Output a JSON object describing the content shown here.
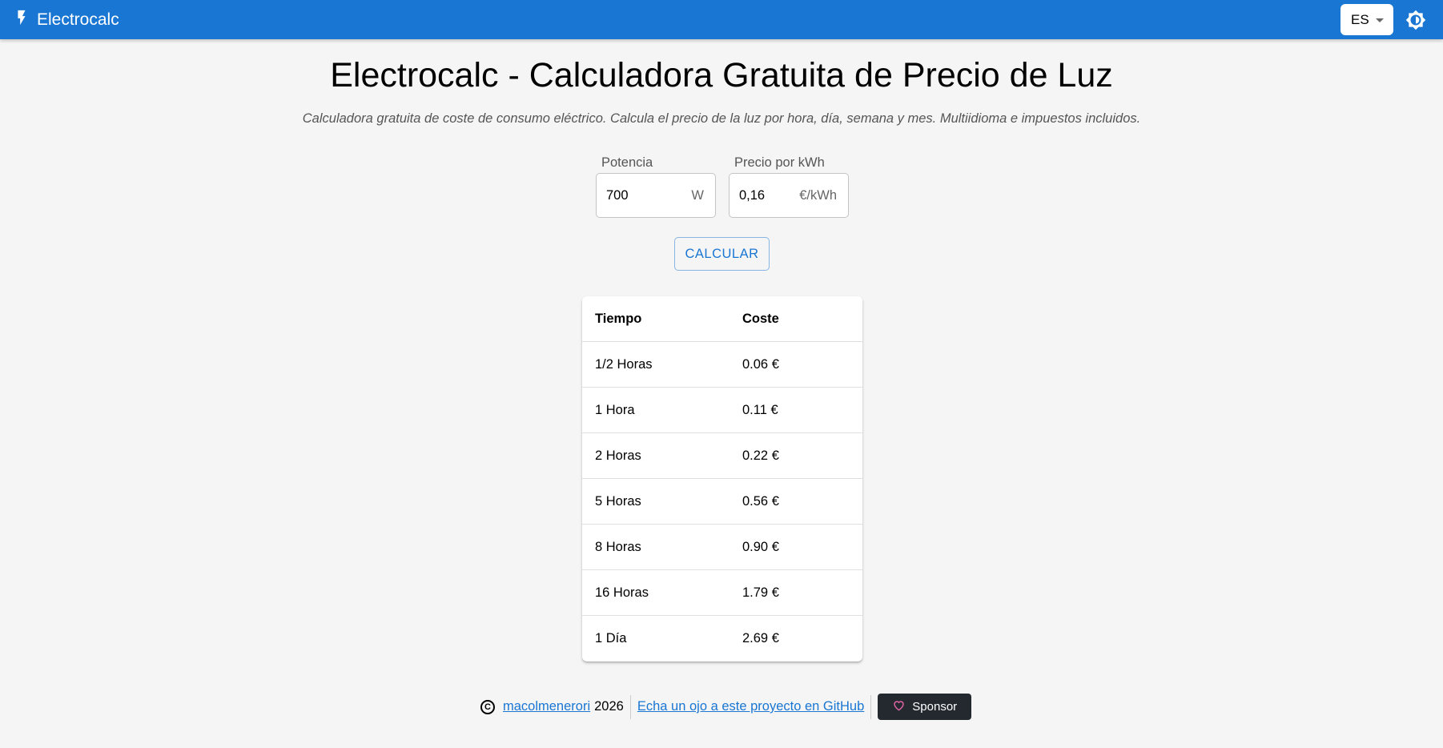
{
  "header": {
    "brand_icon": "bolt-icon",
    "brand": "Electrocalc",
    "language": "ES",
    "theme_icon": "brightness-icon",
    "color": "#1976d2"
  },
  "page": {
    "title": "Electrocalc - Calculadora Gratuita de Precio de Luz",
    "subtitle": "Calculadora gratuita de coste de consumo eléctrico. Calcula el precio de la luz por hora, día, semana y mes. Multiidioma e impuestos incluidos."
  },
  "form": {
    "power": {
      "label": "Potencia",
      "value": "700",
      "unit": "W"
    },
    "price": {
      "label": "Precio por kWh",
      "value": "0,16",
      "unit": "€/kWh"
    },
    "calculate_label": "CALCULAR"
  },
  "table": {
    "headers": {
      "time": "Tiempo",
      "cost": "Coste"
    },
    "rows": [
      {
        "time": "1/2 Horas",
        "cost": "0.06 €"
      },
      {
        "time": "1 Hora",
        "cost": "0.11 €"
      },
      {
        "time": "2 Horas",
        "cost": "0.22 €"
      },
      {
        "time": "5 Horas",
        "cost": "0.56 €"
      },
      {
        "time": "8 Horas",
        "cost": "0.90 €"
      },
      {
        "time": "16 Horas",
        "cost": "1.79 €"
      },
      {
        "time": "1 Día",
        "cost": "2.69 €"
      }
    ]
  },
  "footer": {
    "copyright_icon": "copyright-icon",
    "author": "macolmenerori",
    "year": "2026",
    "github_link": "Echa un ojo a este proyecto en GitHub",
    "sponsor_icon": "heart-icon",
    "sponsor_label": "Sponsor"
  }
}
